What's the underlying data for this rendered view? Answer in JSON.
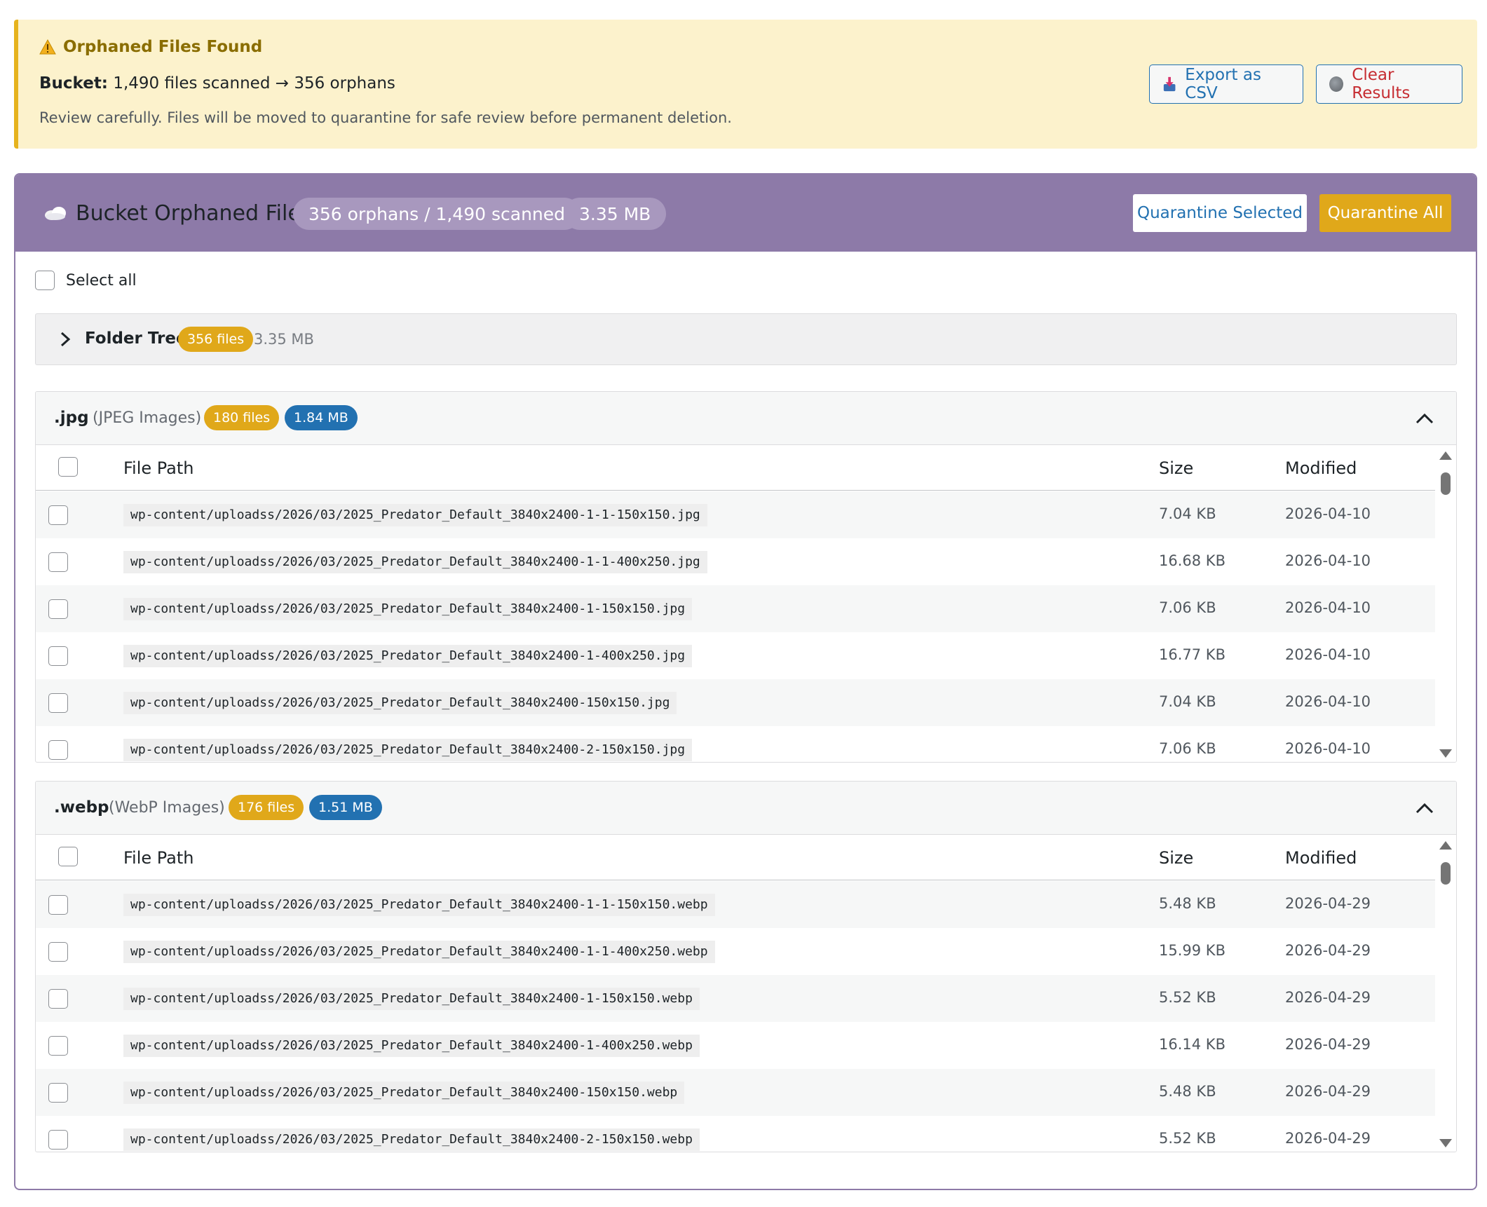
{
  "notice": {
    "title": "Orphaned Files Found",
    "bucket_label": "Bucket:",
    "bucket_text": "1,490 files scanned → 356 orphans",
    "description": "Review carefully. Files will be moved to quarantine for safe review before permanent deletion.",
    "export_label": "Export as CSV",
    "clear_label": "Clear Results"
  },
  "panel": {
    "title": "Bucket Orphaned Files",
    "count_pill": "356 orphans / 1,490 scanned",
    "size_pill": "3.35 MB",
    "quarantine_selected": "Quarantine Selected",
    "quarantine_all": "Quarantine All",
    "select_all": "Select all"
  },
  "folder_tree": {
    "label": "Folder Tree",
    "files_badge": "356 files",
    "size": "3.35 MB"
  },
  "columns": {
    "path": "File Path",
    "size": "Size",
    "modified": "Modified"
  },
  "groups": [
    {
      "ext": ".jpg",
      "desc": "(JPEG Images)",
      "files_badge": "180 files",
      "size_badge": "1.84 MB",
      "rows": [
        {
          "path": "wp-content/uploadss/2026/03/2025_Predator_Default_3840x2400-1-1-150x150.jpg",
          "size": "7.04 KB",
          "modified": "2026-04-10"
        },
        {
          "path": "wp-content/uploadss/2026/03/2025_Predator_Default_3840x2400-1-1-400x250.jpg",
          "size": "16.68 KB",
          "modified": "2026-04-10"
        },
        {
          "path": "wp-content/uploadss/2026/03/2025_Predator_Default_3840x2400-1-150x150.jpg",
          "size": "7.06 KB",
          "modified": "2026-04-10"
        },
        {
          "path": "wp-content/uploadss/2026/03/2025_Predator_Default_3840x2400-1-400x250.jpg",
          "size": "16.77 KB",
          "modified": "2026-04-10"
        },
        {
          "path": "wp-content/uploadss/2026/03/2025_Predator_Default_3840x2400-150x150.jpg",
          "size": "7.04 KB",
          "modified": "2026-04-10"
        },
        {
          "path": "wp-content/uploadss/2026/03/2025_Predator_Default_3840x2400-2-150x150.jpg",
          "size": "7.06 KB",
          "modified": "2026-04-10"
        }
      ]
    },
    {
      "ext": ".webp",
      "desc": "(WebP Images)",
      "files_badge": "176 files",
      "size_badge": "1.51 MB",
      "rows": [
        {
          "path": "wp-content/uploadss/2026/03/2025_Predator_Default_3840x2400-1-1-150x150.webp",
          "size": "5.48 KB",
          "modified": "2026-04-29"
        },
        {
          "path": "wp-content/uploadss/2026/03/2025_Predator_Default_3840x2400-1-1-400x250.webp",
          "size": "15.99 KB",
          "modified": "2026-04-29"
        },
        {
          "path": "wp-content/uploadss/2026/03/2025_Predator_Default_3840x2400-1-150x150.webp",
          "size": "5.52 KB",
          "modified": "2026-04-29"
        },
        {
          "path": "wp-content/uploadss/2026/03/2025_Predator_Default_3840x2400-1-400x250.webp",
          "size": "16.14 KB",
          "modified": "2026-04-29"
        },
        {
          "path": "wp-content/uploadss/2026/03/2025_Predator_Default_3840x2400-150x150.webp",
          "size": "5.48 KB",
          "modified": "2026-04-29"
        },
        {
          "path": "wp-content/uploadss/2026/03/2025_Predator_Default_3840x2400-2-150x150.webp",
          "size": "5.52 KB",
          "modified": "2026-04-29"
        }
      ]
    }
  ],
  "colors": {
    "panel_purple": "#8d7aa8",
    "accent_orange": "#e0a81a",
    "accent_blue": "#2271b1",
    "notice_bg": "#fcf2cc",
    "danger_red": "#c62d32"
  },
  "icons": {
    "notice": "warning-icon",
    "export": "export-icon",
    "clear": "clear-icon",
    "panel": "cloud-icon",
    "tree_toggle": "chevron-right-icon",
    "group_toggle": "chevron-up-icon"
  }
}
